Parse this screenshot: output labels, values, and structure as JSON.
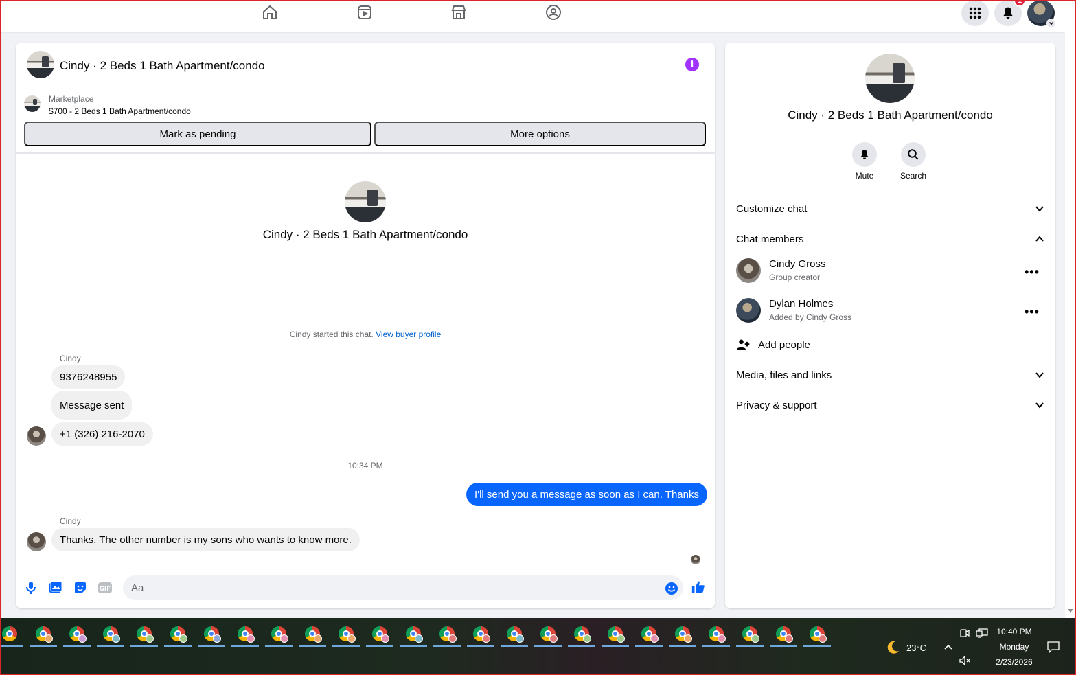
{
  "header": {
    "nav": [
      "home-icon",
      "video-icon",
      "marketplace-icon",
      "groups-icon"
    ],
    "notifications_count": "1"
  },
  "chat": {
    "title": "Cindy · 2 Beds 1 Bath Apartment/condo",
    "marketplace_label": "Marketplace",
    "listing": "$700 - 2 Beds 1 Bath Apartment/condo",
    "mark_pending": "Mark as pending",
    "more_options": "More options",
    "center_title": "Cindy · 2 Beds 1 Bath Apartment/condo",
    "system_prefix": "Cindy started this chat.",
    "system_link": "View buyer profile",
    "messages": [
      {
        "sender": "Cindy",
        "text": "9376248955"
      },
      {
        "text": "Message sent"
      },
      {
        "text": "+1 (326) 216-2070"
      },
      {
        "time": "10:34 PM"
      },
      {
        "outgoing": true,
        "text": "I'll send you a message as soon as I can. Thanks"
      },
      {
        "sender": "Cindy",
        "text": "Thanks. The other number is my sons who wants to know more."
      }
    ],
    "composer_placeholder": "Aa"
  },
  "side": {
    "title": "Cindy · 2 Beds 1 Bath Apartment/condo",
    "mute": "Mute",
    "search": "Search",
    "customize": "Customize chat",
    "members_label": "Chat members",
    "members": [
      {
        "name": "Cindy Gross",
        "role": "Group creator"
      },
      {
        "name": "Dylan Holmes",
        "role": "Added by Cindy Gross"
      }
    ],
    "add_people": "Add people",
    "media": "Media, files and links",
    "privacy": "Privacy & support"
  },
  "taskbar": {
    "temperature": "23°C",
    "time": "10:40 PM",
    "day": "Monday",
    "date": "2/23/2026"
  },
  "colors": {
    "accent": "#0866ff",
    "info": "#a033ff",
    "badge": "#e41e3f"
  }
}
